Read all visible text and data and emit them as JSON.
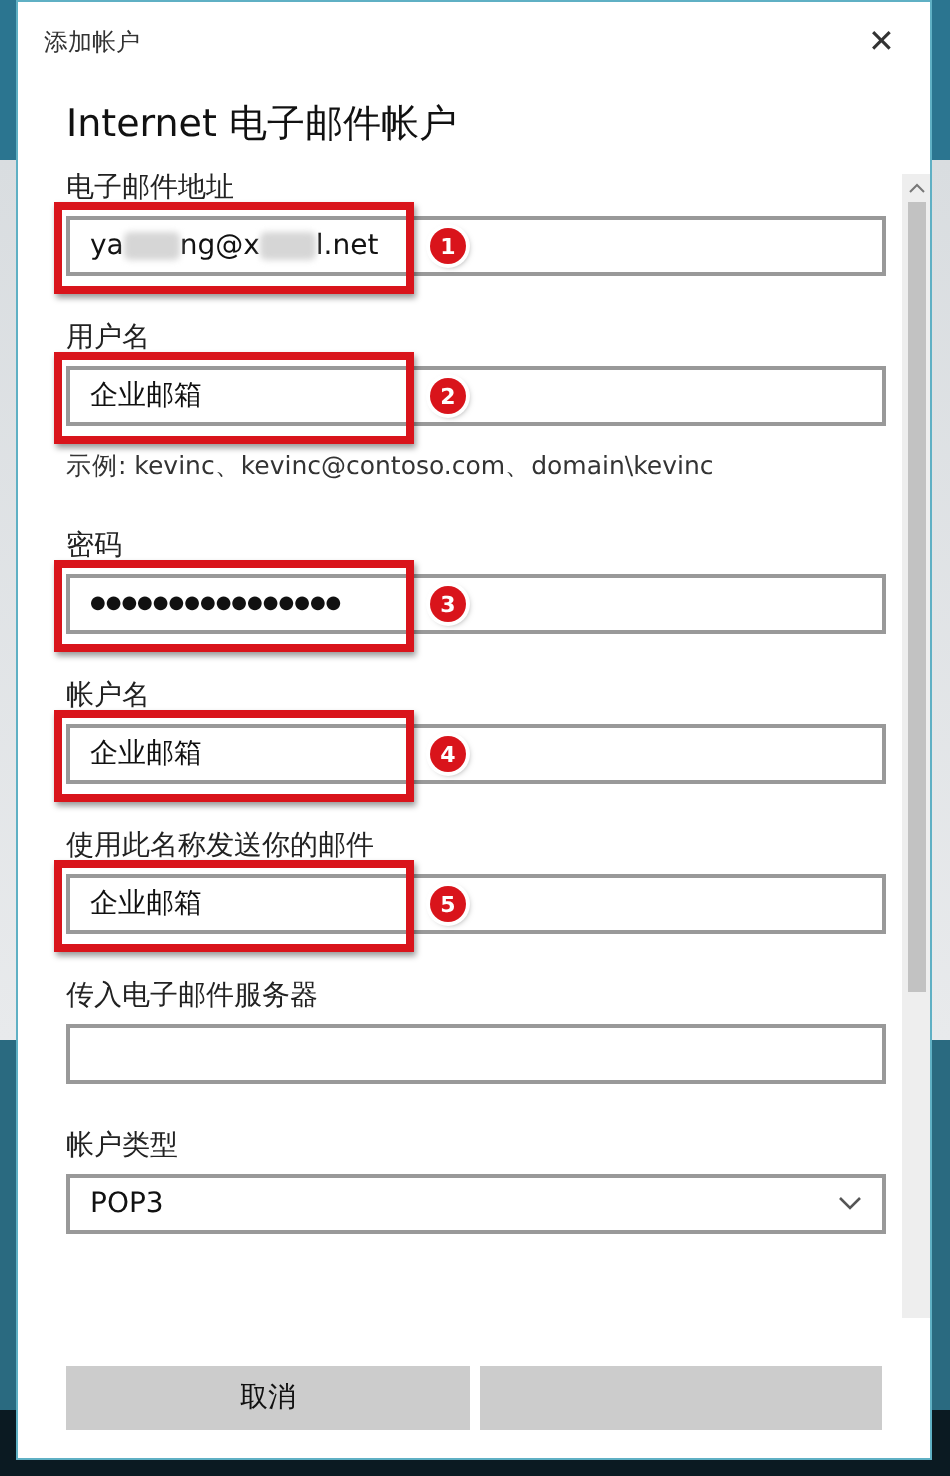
{
  "window": {
    "title": "添加帐户",
    "close": "✕"
  },
  "heading": "Internet 电子邮件帐户",
  "fields": [
    {
      "kind": "segmented",
      "label": "电子邮件地址",
      "annotation": "1",
      "segments": [
        {
          "kind": "text",
          "text": "ya"
        },
        {
          "kind": "blurred"
        },
        {
          "kind": "text",
          "text": "ng@x"
        },
        {
          "kind": "blurred"
        },
        {
          "kind": "text",
          "text": "l.net"
        }
      ]
    },
    {
      "kind": "text",
      "label": "用户名",
      "annotation": "2",
      "value": "企业邮箱",
      "hint": "示例: kevinc、kevinc@contoso.com、domain\\kevinc"
    },
    {
      "kind": "password",
      "label": "密码",
      "annotation": "3",
      "value": "●●●●●●●●●●●●●●●●"
    },
    {
      "kind": "text",
      "label": "帐户名",
      "annotation": "4",
      "value": "企业邮箱"
    },
    {
      "kind": "text",
      "label": "使用此名称发送你的邮件",
      "annotation": "5",
      "value": "企业邮箱"
    },
    {
      "kind": "text",
      "label": "传入电子邮件服务器"
    },
    {
      "kind": "select",
      "label": "帐户类型",
      "value": "POP3"
    }
  ],
  "buttons": [
    {
      "label": "取消"
    }
  ]
}
